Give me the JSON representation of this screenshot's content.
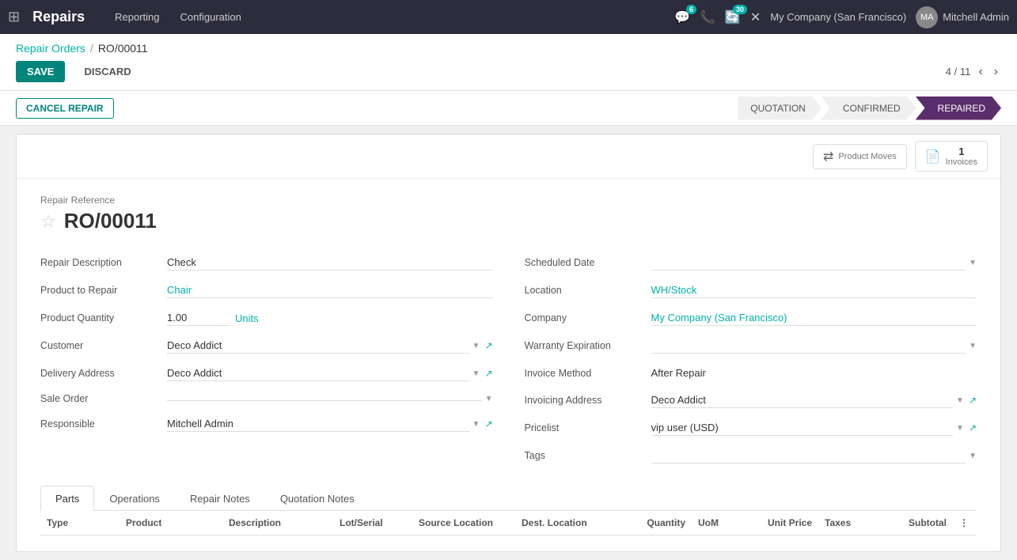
{
  "app": {
    "name": "Repairs",
    "grid_icon": "⊞"
  },
  "topnav": {
    "menu_items": [
      "Reporting",
      "Configuration"
    ],
    "icons": {
      "chat": {
        "icon": "💬",
        "badge": "6"
      },
      "phone": {
        "icon": "📞"
      },
      "refresh": {
        "icon": "🔄",
        "badge": "30"
      },
      "wrench": {
        "icon": "✕"
      }
    },
    "company": "My Company (San Francisco)",
    "user": "Mitchell Admin"
  },
  "breadcrumb": {
    "parent": "Repair Orders",
    "separator": "/",
    "current": "RO/00011"
  },
  "actions": {
    "save": "SAVE",
    "discard": "DISCARD",
    "pagination": "4 / 11"
  },
  "status_bar": {
    "cancel_btn": "CANCEL REPAIR",
    "stages": [
      {
        "label": "QUOTATION",
        "state": "done"
      },
      {
        "label": "CONFIRMED",
        "state": "done"
      },
      {
        "label": "REPAIRED",
        "state": "active"
      }
    ]
  },
  "smart_buttons": [
    {
      "icon": "⇄",
      "label": "Product Moves",
      "count": null
    },
    {
      "icon": "📄",
      "label": "Invoices",
      "count": "1"
    }
  ],
  "form": {
    "repair_ref_label": "Repair Reference",
    "repair_ref": "RO/00011",
    "left_fields": [
      {
        "label": "Repair Description",
        "value": "Check",
        "type": "text"
      },
      {
        "label": "Product to Repair",
        "value": "Chair",
        "type": "link"
      },
      {
        "label": "Product Quantity",
        "value": "1.00",
        "unit": "Units",
        "type": "quantity"
      },
      {
        "label": "Customer",
        "value": "Deco Addict",
        "type": "select-ext"
      },
      {
        "label": "Delivery Address",
        "value": "Deco Addict",
        "type": "select-ext"
      },
      {
        "label": "Sale Order",
        "value": "",
        "type": "select"
      },
      {
        "label": "Responsible",
        "value": "Mitchell Admin",
        "type": "select-ext"
      }
    ],
    "right_fields": [
      {
        "label": "Scheduled Date",
        "value": "",
        "type": "select"
      },
      {
        "label": "Location",
        "value": "WH/Stock",
        "type": "link"
      },
      {
        "label": "Company",
        "value": "My Company (San Francisco)",
        "type": "link"
      },
      {
        "label": "Warranty Expiration",
        "value": "",
        "type": "select"
      },
      {
        "label": "Invoice Method",
        "value": "After Repair",
        "type": "text"
      },
      {
        "label": "Invoicing Address",
        "value": "Deco Addict",
        "type": "select-ext"
      },
      {
        "label": "Pricelist",
        "value": "vip user (USD)",
        "type": "select-ext"
      },
      {
        "label": "Tags",
        "value": "",
        "type": "select"
      }
    ]
  },
  "tabs": [
    {
      "label": "Parts",
      "active": true
    },
    {
      "label": "Operations",
      "active": false
    },
    {
      "label": "Repair Notes",
      "active": false
    },
    {
      "label": "Quotation Notes",
      "active": false
    }
  ],
  "table_headers": [
    {
      "label": "Type",
      "key": "type"
    },
    {
      "label": "Product",
      "key": "product"
    },
    {
      "label": "Description",
      "key": "description"
    },
    {
      "label": "Lot/Serial",
      "key": "lot"
    },
    {
      "label": "Source Location",
      "key": "source"
    },
    {
      "label": "Dest. Location",
      "key": "dest"
    },
    {
      "label": "Quantity",
      "key": "qty"
    },
    {
      "label": "UoM",
      "key": "uom"
    },
    {
      "label": "Unit Price",
      "key": "price"
    },
    {
      "label": "Taxes",
      "key": "taxes"
    },
    {
      "label": "Subtotal",
      "key": "subtotal"
    }
  ],
  "url_bar": "https://12391513-15-0-all-pvnhaf63.odoo.com/web#..."
}
